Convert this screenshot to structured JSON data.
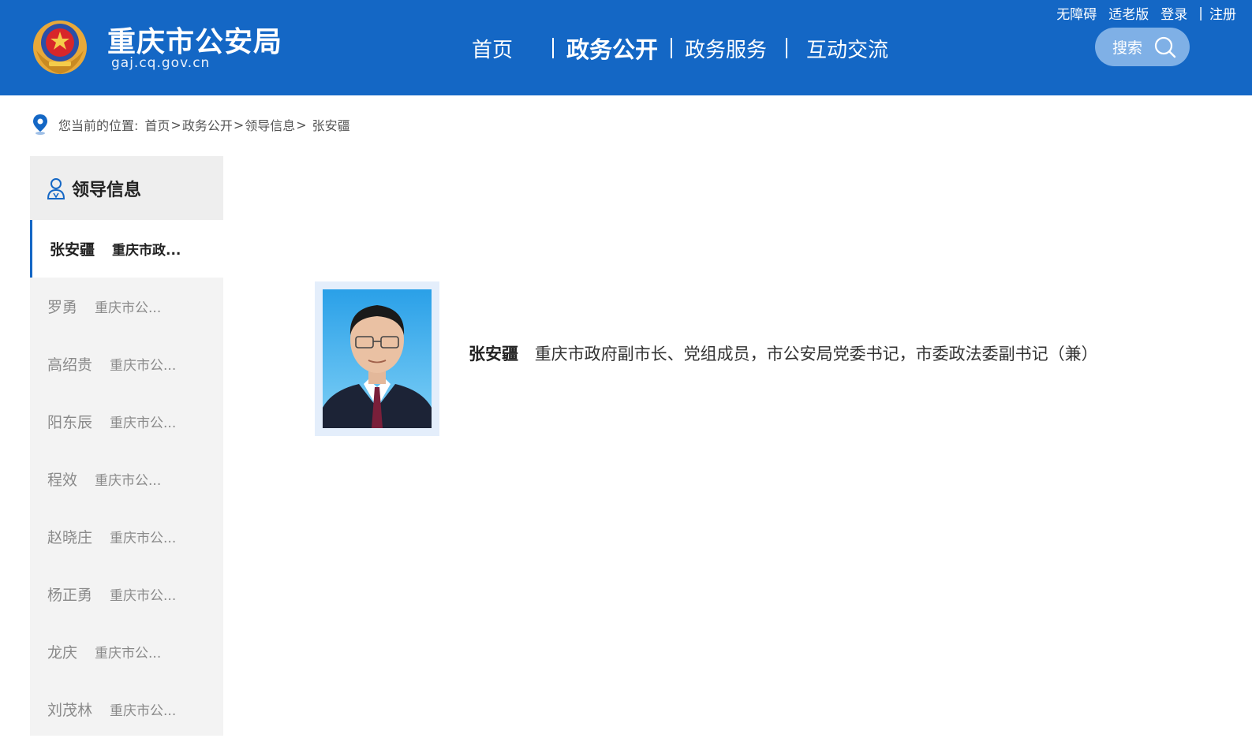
{
  "header": {
    "site_title": "重庆市公安局",
    "site_domain": "gaj.cq.gov.cn",
    "brand_color": "#1467c5",
    "nav": [
      {
        "label": "首页"
      },
      {
        "label": "政务公开",
        "active": true
      },
      {
        "label": "政务服务"
      },
      {
        "label": "互动交流"
      }
    ],
    "topbar": {
      "accessibility": "无障碍",
      "elderly": "适老版",
      "login": "登录",
      "separator": "|",
      "register": "注册"
    },
    "search_label": "搜索"
  },
  "breadcrumb": {
    "prefix": "您当前的位置:",
    "items": [
      "首页",
      "政务公开",
      "领导信息"
    ],
    "separator": ">",
    "current": "张安疆"
  },
  "sidebar": {
    "title": "领导信息",
    "items": [
      {
        "name": "张安疆",
        "post": "重庆市政...",
        "active": true
      },
      {
        "name": "罗勇",
        "post": "重庆市公..."
      },
      {
        "name": "高绍贵",
        "post": "重庆市公..."
      },
      {
        "name": "阳东辰",
        "post": "重庆市公..."
      },
      {
        "name": "程效",
        "post": "重庆市公..."
      },
      {
        "name": "赵晓庄",
        "post": "重庆市公..."
      },
      {
        "name": "杨正勇",
        "post": "重庆市公..."
      },
      {
        "name": "龙庆",
        "post": "重庆市公..."
      },
      {
        "name": "刘茂林",
        "post": "重庆市公..."
      }
    ]
  },
  "profile": {
    "name": "张安疆",
    "title": "重庆市政府副市长、党组成员，市公安局党委书记，市委政法委副书记（兼）"
  },
  "icons": {
    "emblem": "police-emblem-icon",
    "search": "search-icon",
    "location": "location-pin-icon",
    "user": "user-icon"
  }
}
